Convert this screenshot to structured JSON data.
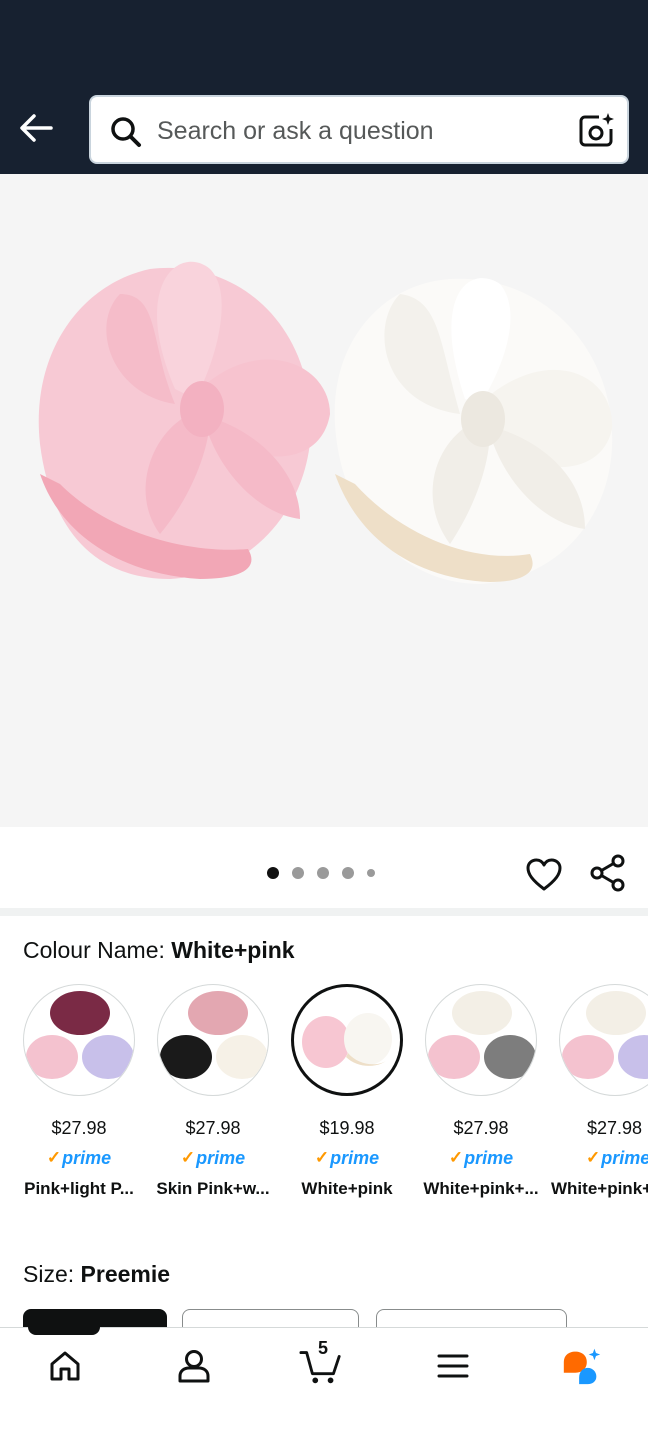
{
  "header": {
    "search_placeholder": "Search or ask a question"
  },
  "gallery": {
    "image_count": 5,
    "active_index": 0
  },
  "colour": {
    "label": "Colour Name: ",
    "selected": "White+pink"
  },
  "swatches": [
    {
      "price": "$27.98",
      "prime": "prime",
      "name": "Pink+light P..."
    },
    {
      "price": "$27.98",
      "prime": "prime",
      "name": "Skin Pink+w..."
    },
    {
      "price": "$19.98",
      "prime": "prime",
      "name": "White+pink"
    },
    {
      "price": "$27.98",
      "prime": "prime",
      "name": "White+pink+..."
    },
    {
      "price": "$27.98",
      "prime": "prime",
      "name": "White+pink+"
    }
  ],
  "size": {
    "label": "Size: ",
    "selected": "Preemie"
  },
  "bottom_nav": {
    "cart_count": "5"
  },
  "colors": {
    "header_bg": "#172130",
    "prime_blue": "#1a98ff",
    "prime_check": "#ff9900",
    "rufus_orange": "#ff6a00",
    "rufus_blue": "#1a98ff"
  }
}
